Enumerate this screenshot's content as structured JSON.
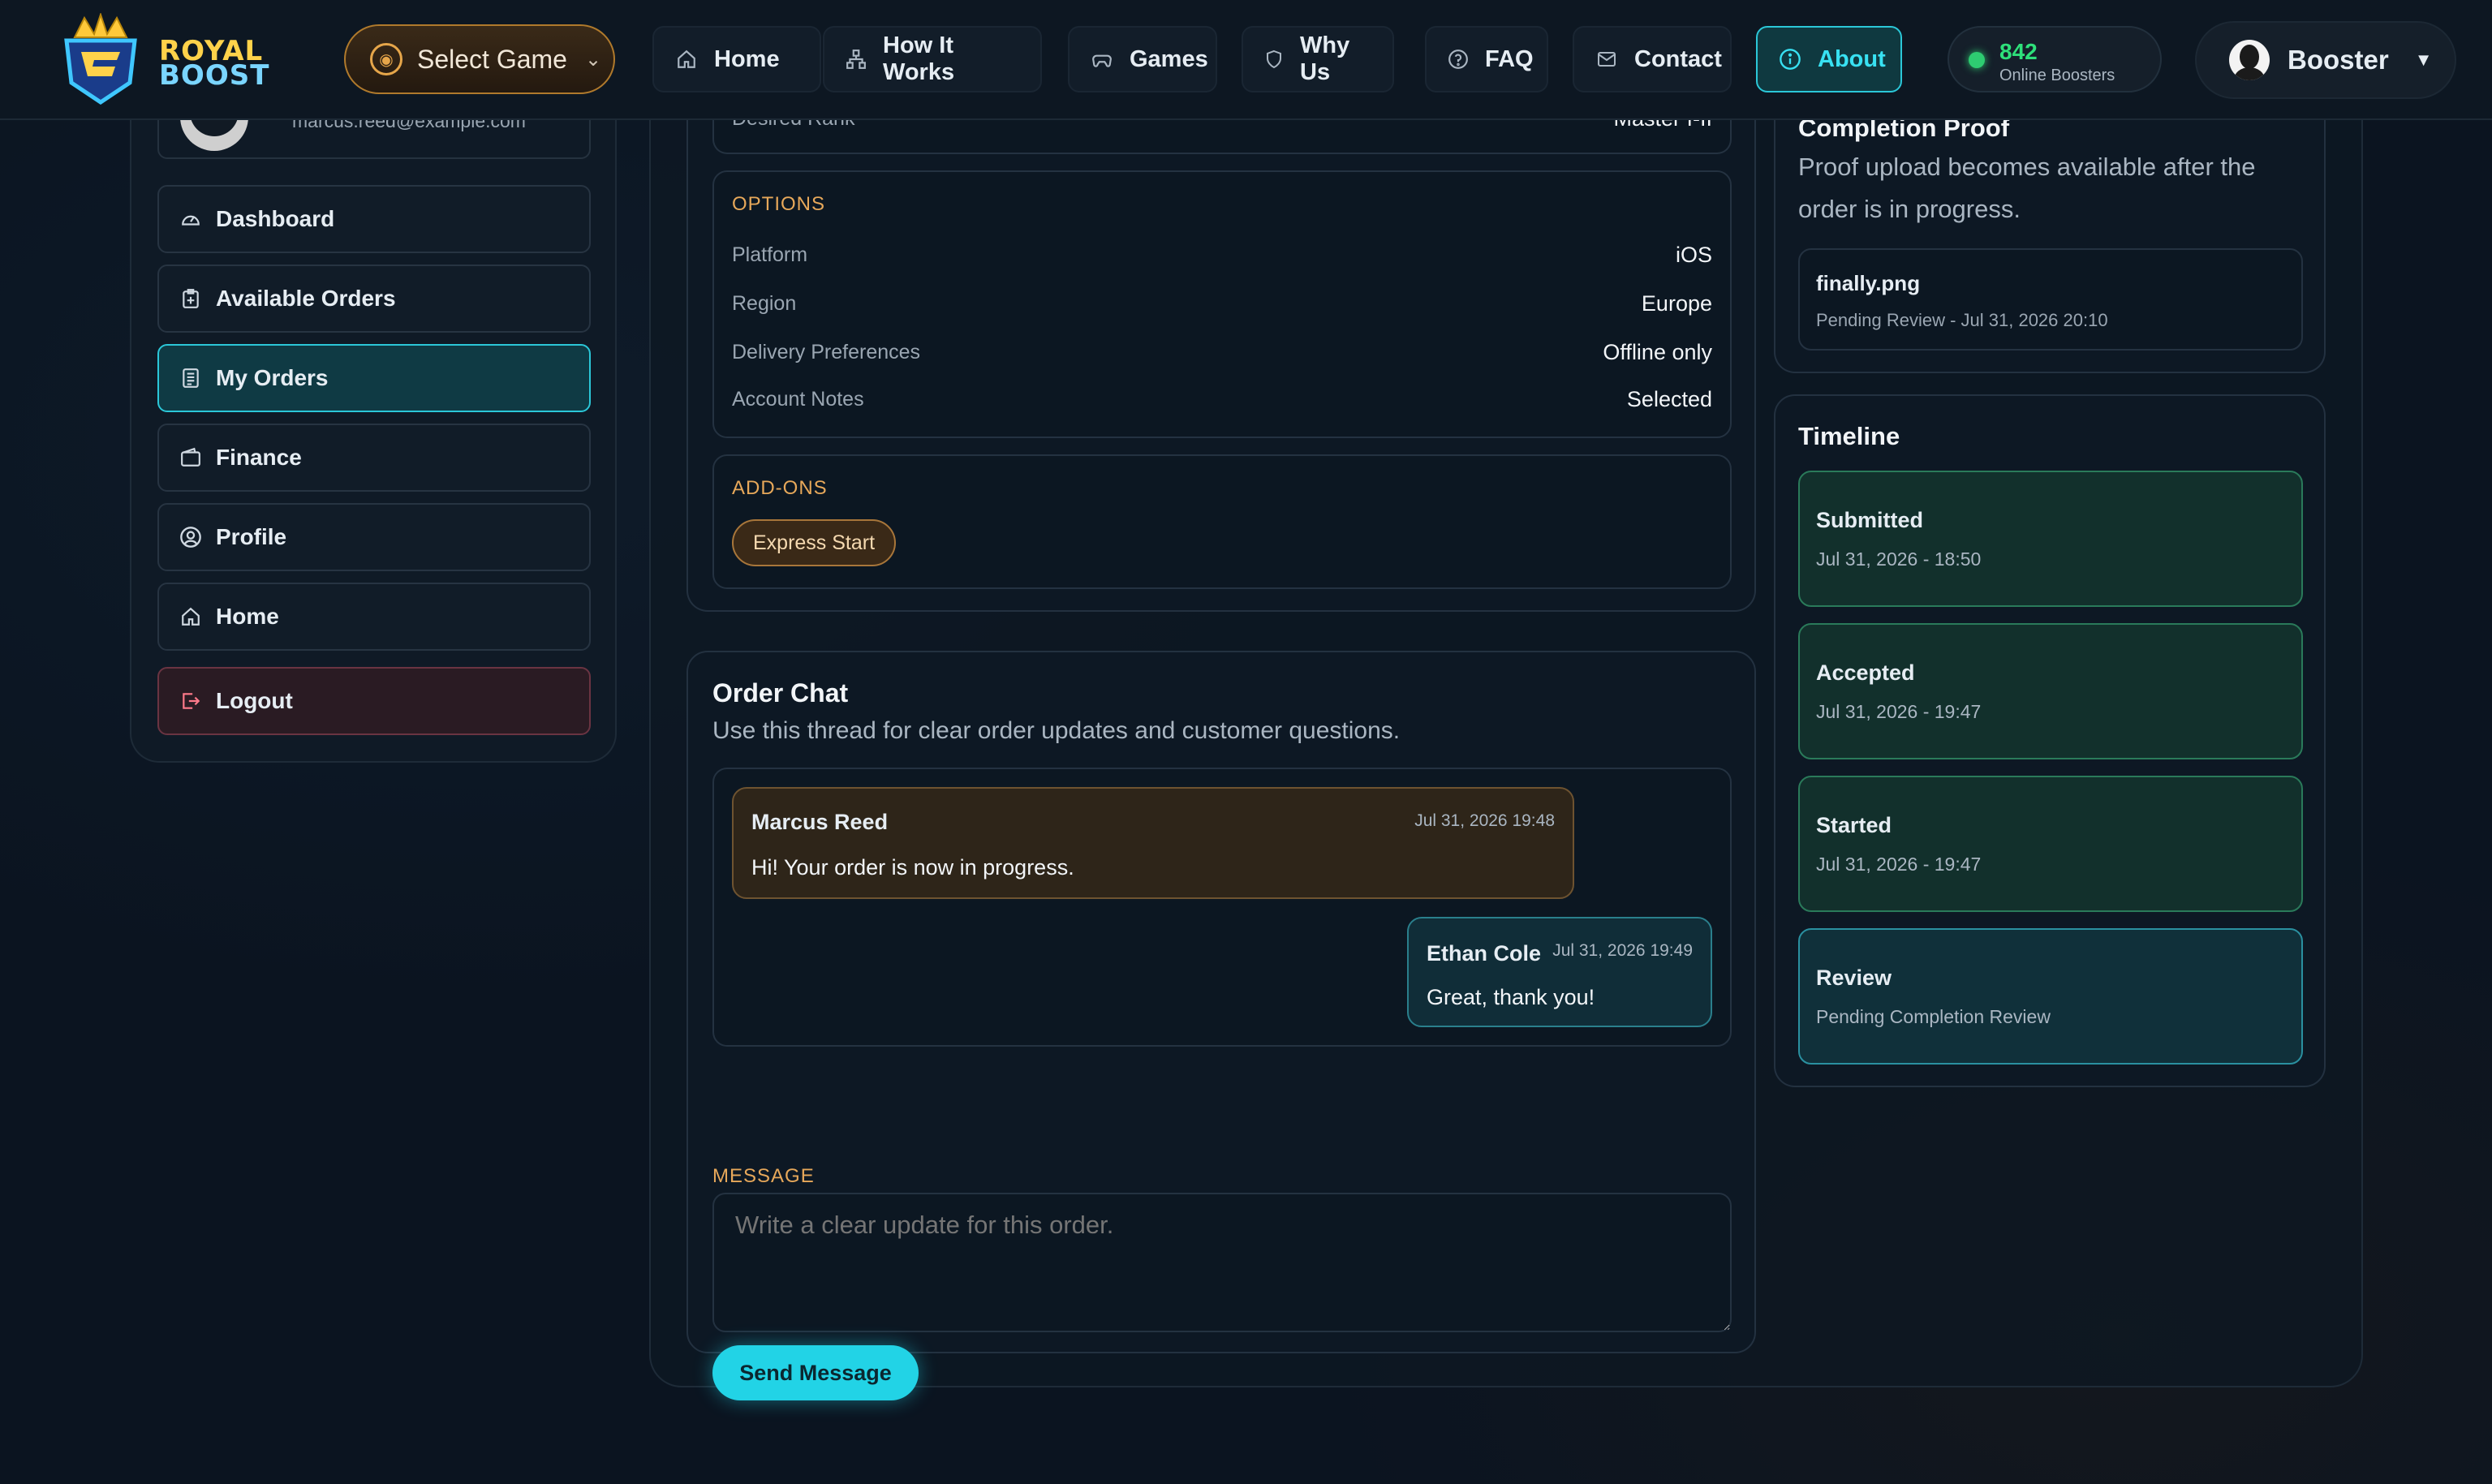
{
  "brand": {
    "line1": "ROYAL",
    "line2": "BOOST"
  },
  "header": {
    "select_game": "Select Game",
    "nav": [
      {
        "label": "Home",
        "icon": "home-icon"
      },
      {
        "label": "How It Works",
        "icon": "sitemap-icon"
      },
      {
        "label": "Games",
        "icon": "gamepad-icon"
      },
      {
        "label": "Why Us",
        "icon": "shield-icon"
      },
      {
        "label": "FAQ",
        "icon": "question-icon"
      },
      {
        "label": "Contact",
        "icon": "envelope-icon"
      },
      {
        "label": "About",
        "icon": "info-icon",
        "active": true
      }
    ],
    "online_count": "842",
    "online_label": "Online Boosters",
    "user_label": "Booster"
  },
  "sidebar": {
    "email": "marcus.reed@example.com",
    "items": [
      {
        "label": "Dashboard",
        "icon": "gauge-icon"
      },
      {
        "label": "Available Orders",
        "icon": "clipboard-plus-icon"
      },
      {
        "label": "My Orders",
        "icon": "list-icon",
        "active": true
      },
      {
        "label": "Finance",
        "icon": "wallet-icon"
      },
      {
        "label": "Profile",
        "icon": "user-circle-icon"
      },
      {
        "label": "Home",
        "icon": "home-icon"
      },
      {
        "label": "Logout",
        "icon": "logout-icon"
      }
    ]
  },
  "order": {
    "top_row_label": "Desired Rank",
    "top_row_value": "Master I-II",
    "options_label": "OPTIONS",
    "options": [
      {
        "key": "Platform",
        "value": "iOS"
      },
      {
        "key": "Region",
        "value": "Europe"
      },
      {
        "key": "Delivery Preferences",
        "value": "Offline only"
      },
      {
        "key": "Account Notes",
        "value": "Selected"
      }
    ],
    "addons_label": "ADD-ONS",
    "addons": [
      "Express Start"
    ]
  },
  "chat": {
    "title": "Order Chat",
    "subtitle": "Use this thread for clear order updates and customer questions.",
    "messages": [
      {
        "name": "Marcus Reed",
        "time": "Jul 31, 2026 19:48",
        "text": "Hi! Your order is now in progress."
      },
      {
        "name": "Ethan Cole",
        "time": "Jul 31, 2026 19:49",
        "text": "Great, thank you!"
      }
    ],
    "message_label": "MESSAGE",
    "placeholder": "Write a clear update for this order.",
    "send_label": "Send Message"
  },
  "proof": {
    "title": "Completion Proof",
    "subtitle": "Proof upload becomes available after the order is in progress.",
    "file_name": "finally.png",
    "file_status": "Pending Review - Jul 31, 2026 20:10"
  },
  "timeline": {
    "title": "Timeline",
    "items": [
      {
        "title": "Submitted",
        "time": "Jul 31, 2026 - 18:50"
      },
      {
        "title": "Accepted",
        "time": "Jul 31, 2026 - 19:47"
      },
      {
        "title": "Started",
        "time": "Jul 31, 2026 - 19:47"
      },
      {
        "title": "Review",
        "time": "Pending Completion Review"
      }
    ]
  },
  "colors": {
    "accent": "#22d3e6",
    "gold": "#e7a85a",
    "online": "#2ee07a",
    "background": "#0b1420"
  }
}
